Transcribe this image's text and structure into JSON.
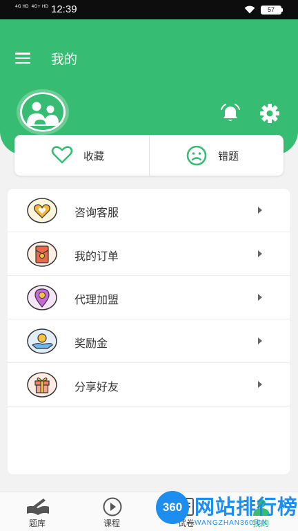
{
  "status_bar": {
    "network_1": "4G HD",
    "network_2": "4G+ HD",
    "time": "12:39",
    "battery": "57"
  },
  "header": {
    "title": "我的"
  },
  "quick_actions": [
    {
      "label": "收藏",
      "icon": "heart-icon"
    },
    {
      "label": "错题",
      "icon": "sad-face-icon"
    }
  ],
  "menu": [
    {
      "label": "咨询客服",
      "icon": "heart-badge-icon"
    },
    {
      "label": "我的订单",
      "icon": "red-envelope-icon"
    },
    {
      "label": "代理加盟",
      "icon": "location-pin-icon"
    },
    {
      "label": "奖励金",
      "icon": "coin-hand-icon"
    },
    {
      "label": "分享好友",
      "icon": "gift-icon"
    }
  ],
  "bottom_nav": [
    {
      "label": "题库",
      "icon": "book-pen-icon",
      "active": false
    },
    {
      "label": "课程",
      "icon": "play-circle-icon",
      "active": false
    },
    {
      "label": "试卷",
      "icon": "paper-icon",
      "active": false
    },
    {
      "label": "我的",
      "icon": "user-icon",
      "active": true
    }
  ],
  "watermark": {
    "badge": "360",
    "text": "网站排行榜",
    "sub": "WANGZHAN360.CN"
  },
  "colors": {
    "brand_green": "#37bd73",
    "status_bar_bg": "#0d0d0d",
    "page_bg": "#f2f2f2",
    "watermark_blue": "#1d8df0"
  }
}
